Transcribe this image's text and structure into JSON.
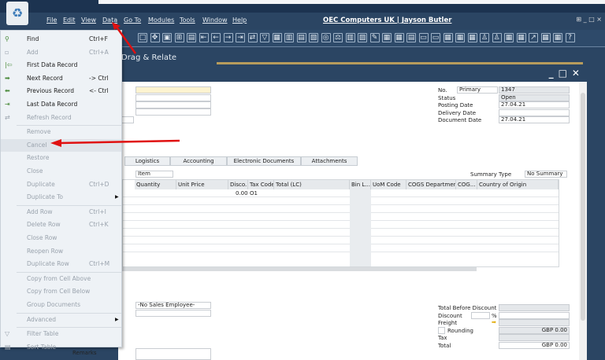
{
  "desktop": {
    "recycle_bin_icon": "recycle-bin-icon"
  },
  "menubar": {
    "items": [
      "File",
      "Edit",
      "View",
      "Data",
      "Go To",
      "Modules",
      "Tools",
      "Window",
      "Help"
    ],
    "title": "OEC Computers UK | Jayson Butler"
  },
  "tabs": {
    "drag_relate": "Drag & Relate"
  },
  "data_menu": {
    "items": [
      {
        "label": "Find",
        "shortcut": "Ctrl+F",
        "enabled": true,
        "icon": "binoculars-icon"
      },
      {
        "label": "Add",
        "shortcut": "Ctrl+A",
        "enabled": false,
        "icon": "add-icon"
      },
      {
        "label": "First Data Record",
        "shortcut": "",
        "enabled": true,
        "icon": "first-record-icon"
      },
      {
        "label": "Next Record",
        "shortcut": "-> Ctrl",
        "enabled": true,
        "icon": "next-record-icon"
      },
      {
        "label": "Previous Record",
        "shortcut": "<- Ctrl",
        "enabled": true,
        "icon": "previous-record-icon"
      },
      {
        "label": "Last Data Record",
        "shortcut": "",
        "enabled": true,
        "icon": "last-record-icon"
      },
      {
        "label": "Refresh Record",
        "shortcut": "",
        "enabled": false,
        "icon": "refresh-icon"
      },
      {
        "label": "Remove",
        "shortcut": "",
        "enabled": false
      },
      {
        "label": "Cancel",
        "shortcut": "",
        "enabled": false
      },
      {
        "label": "Restore",
        "shortcut": "",
        "enabled": false
      },
      {
        "label": "Close",
        "shortcut": "",
        "enabled": false
      },
      {
        "label": "Duplicate",
        "shortcut": "Ctrl+D",
        "enabled": false
      },
      {
        "label": "Duplicate To",
        "shortcut": "",
        "enabled": false,
        "submenu": true
      },
      {
        "label": "Add Row",
        "shortcut": "Ctrl+I",
        "enabled": false
      },
      {
        "label": "Delete Row",
        "shortcut": "Ctrl+K",
        "enabled": false
      },
      {
        "label": "Close Row",
        "shortcut": "",
        "enabled": false
      },
      {
        "label": "Reopen Row",
        "shortcut": "",
        "enabled": false
      },
      {
        "label": "Duplicate Row",
        "shortcut": "Ctrl+M",
        "enabled": false
      },
      {
        "label": "Copy from Cell Above",
        "shortcut": "",
        "enabled": false
      },
      {
        "label": "Copy from Cell Below",
        "shortcut": "",
        "enabled": false
      },
      {
        "label": "Group Documents",
        "shortcut": "",
        "enabled": false
      },
      {
        "label": "Advanced",
        "shortcut": "",
        "enabled": false,
        "submenu": true
      },
      {
        "label": "Filter Table",
        "shortcut": "",
        "enabled": false,
        "icon": "filter-icon"
      },
      {
        "label": "Sort Table",
        "shortcut": "",
        "enabled": false,
        "icon": "sort-icon"
      }
    ]
  },
  "header": {
    "no_label": "No.",
    "series": "Primary",
    "number": "1347",
    "status_label": "Status",
    "status": "Open",
    "posting_date_label": "Posting Date",
    "posting_date": "27.04.21",
    "delivery_date_label": "Delivery Date",
    "delivery_date": "",
    "document_date_label": "Document Date",
    "document_date": "27.04.21"
  },
  "doc_tabs": [
    "Logistics",
    "Accounting",
    "Electronic Documents",
    "Attachments"
  ],
  "grid": {
    "item_type": "Item",
    "summary_type_label": "Summary Type",
    "summary_type": "No Summary",
    "columns": [
      "Quantity",
      "Unit Price",
      "Disco...",
      "Tax Code",
      "Total (LC)",
      "Bin L...",
      "UoM Code",
      "COGS Departments",
      "COG...",
      "Country of Origin"
    ],
    "rows": [
      [
        "",
        "",
        "0.00",
        "O1",
        "",
        "",
        "",
        "",
        "",
        ""
      ]
    ]
  },
  "footer": {
    "sales_employee": "-No Sales Employee-",
    "remarks_label": "Remarks",
    "total_before_discount_label": "Total Before Discount",
    "total_before_discount": "",
    "discount_label": "Discount",
    "discount_pct_sign": "%",
    "freight_label": "Freight",
    "rounding_label": "Rounding",
    "rounding": "GBP 0.00",
    "tax_label": "Tax",
    "tax": "",
    "total_label": "Total",
    "total": "GBP 0.00"
  },
  "annotation_color": "#e01010"
}
